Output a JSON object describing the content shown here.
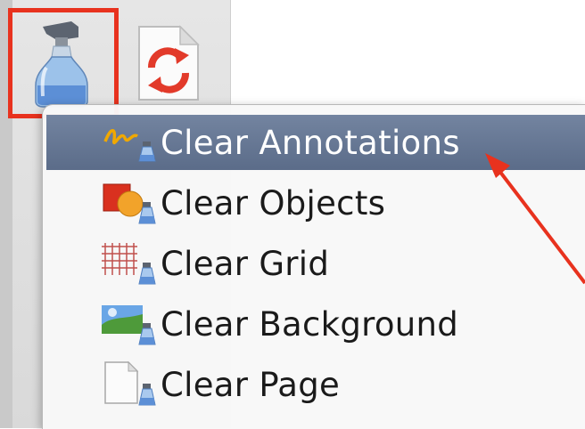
{
  "toolbar": {
    "tools": [
      {
        "icon": "spray-bottle-icon"
      },
      {
        "icon": "refresh-page-icon"
      }
    ]
  },
  "menu": {
    "items": [
      {
        "label": "Clear Annotations",
        "icon": "clear-annotations-icon",
        "selected": true
      },
      {
        "label": "Clear Objects",
        "icon": "clear-objects-icon",
        "selected": false
      },
      {
        "label": "Clear Grid",
        "icon": "clear-grid-icon",
        "selected": false
      },
      {
        "label": "Clear Background",
        "icon": "clear-background-icon",
        "selected": false
      },
      {
        "label": "Clear Page",
        "icon": "clear-page-icon",
        "selected": false
      }
    ]
  },
  "colors": {
    "highlight": "#e8321e",
    "selection": "#5f708c"
  }
}
